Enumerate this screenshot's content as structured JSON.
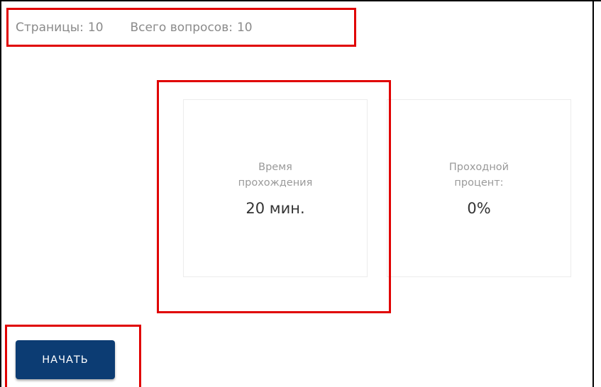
{
  "header": {
    "pages_label": "Страницы:",
    "pages_count": "10",
    "questions_label": "Всего вопросов:",
    "questions_count": "10"
  },
  "cards": {
    "time": {
      "label": "Время\nпрохождения",
      "value": "20 мин."
    },
    "pass": {
      "label": "Проходной\nпроцент:",
      "value": "0%"
    }
  },
  "actions": {
    "start_label": "НАЧАТЬ"
  },
  "colors": {
    "primary_button": "#0c3c73",
    "highlight": "#e00000",
    "muted_text": "#8a8a8a"
  }
}
